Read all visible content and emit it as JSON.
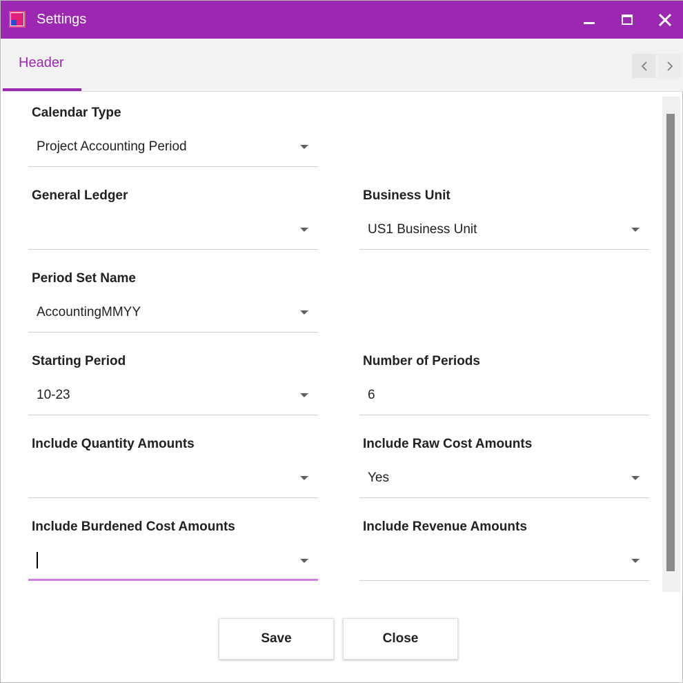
{
  "window": {
    "title": "Settings",
    "accent_color": "#9c27b0",
    "icon": "app-logo-icon",
    "controls": [
      "minimize-icon",
      "maximize-icon",
      "close-icon"
    ]
  },
  "tabs": {
    "items": [
      {
        "label": "Header",
        "active": true
      }
    ],
    "nav": [
      "chevron-left-icon",
      "chevron-right-icon"
    ]
  },
  "form": {
    "calendar_type": {
      "label": "Calendar Type",
      "value": "Project Accounting Period",
      "type": "dropdown"
    },
    "general_ledger": {
      "label": "General Ledger",
      "value": "",
      "type": "dropdown"
    },
    "business_unit": {
      "label": "Business Unit",
      "value": "US1 Business Unit",
      "type": "dropdown"
    },
    "period_set_name": {
      "label": "Period Set Name",
      "value": "AccountingMMYY",
      "type": "dropdown"
    },
    "starting_period": {
      "label": "Starting Period",
      "value": "10-23",
      "type": "dropdown"
    },
    "number_of_periods": {
      "label": "Number of Periods",
      "value": "6",
      "type": "text"
    },
    "include_quantity_amounts": {
      "label": "Include Quantity Amounts",
      "value": "",
      "type": "dropdown"
    },
    "include_raw_cost_amounts": {
      "label": "Include Raw Cost Amounts",
      "value": "Yes",
      "type": "dropdown"
    },
    "include_burdened_cost_amounts": {
      "label": "Include Burdened Cost Amounts",
      "value": "",
      "type": "dropdown",
      "focused": true
    },
    "include_revenue_amounts": {
      "label": "Include Revenue Amounts",
      "value": "",
      "type": "dropdown"
    }
  },
  "buttons": {
    "save": "Save",
    "close": "Close"
  },
  "colors": {
    "title_bar": "#9c27b0",
    "focus_underline": "#cf7fe0",
    "scrollbar_thumb": "#8a8a8a"
  }
}
